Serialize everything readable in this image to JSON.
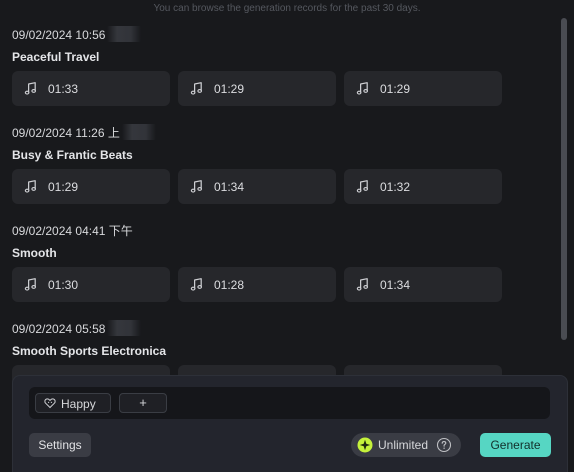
{
  "notice": "You can browse the generation records for the past 30 days.",
  "groups": [
    {
      "date": "09/02/2024 10:56",
      "date_suffix": "",
      "title": "Peaceful Travel",
      "tracks": [
        {
          "duration": "01:33"
        },
        {
          "duration": "01:29"
        },
        {
          "duration": "01:29"
        }
      ]
    },
    {
      "date": "09/02/2024 11:26",
      "date_suffix": "上",
      "title": "Busy & Frantic Beats",
      "tracks": [
        {
          "duration": "01:29"
        },
        {
          "duration": "01:34"
        },
        {
          "duration": "01:32"
        }
      ]
    },
    {
      "date": "09/02/2024 04:41",
      "date_suffix": "下午",
      "title": "Smooth",
      "tracks": [
        {
          "duration": "01:30"
        },
        {
          "duration": "01:28"
        },
        {
          "duration": "01:34"
        }
      ]
    },
    {
      "date": "09/02/2024 05:58",
      "date_suffix": "",
      "title": "Smooth Sports Electronica",
      "tracks": []
    }
  ],
  "prompt_panel": {
    "tags": [
      {
        "label": "Happy",
        "icon": "heart-tag-icon"
      }
    ],
    "add_tag_label": "+",
    "settings_label": "Settings",
    "credits_label": "Unlimited",
    "generate_label": "Generate"
  },
  "colors": {
    "background": "#18191c",
    "card": "#26272b",
    "accent": "#56d6c3",
    "credit_icon": "#c5f23b"
  }
}
